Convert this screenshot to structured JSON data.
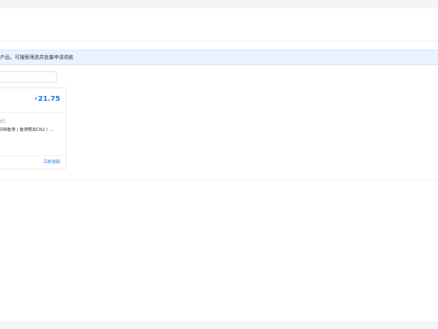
{
  "notice": {
    "text": "产品，可搜索筛选并批量申请退款"
  },
  "search": {
    "placeholder": ""
  },
  "product_card": {
    "currency": "¥",
    "price": "21.75",
    "region_label": "地区",
    "region_path": "中国香港 / 香港精品CN2 / …",
    "refund_label": "立即退款"
  },
  "colors": {
    "accent": "#1677e6",
    "notice_bg": "#e8f3ff",
    "page_bg": "#f4f5f8"
  }
}
